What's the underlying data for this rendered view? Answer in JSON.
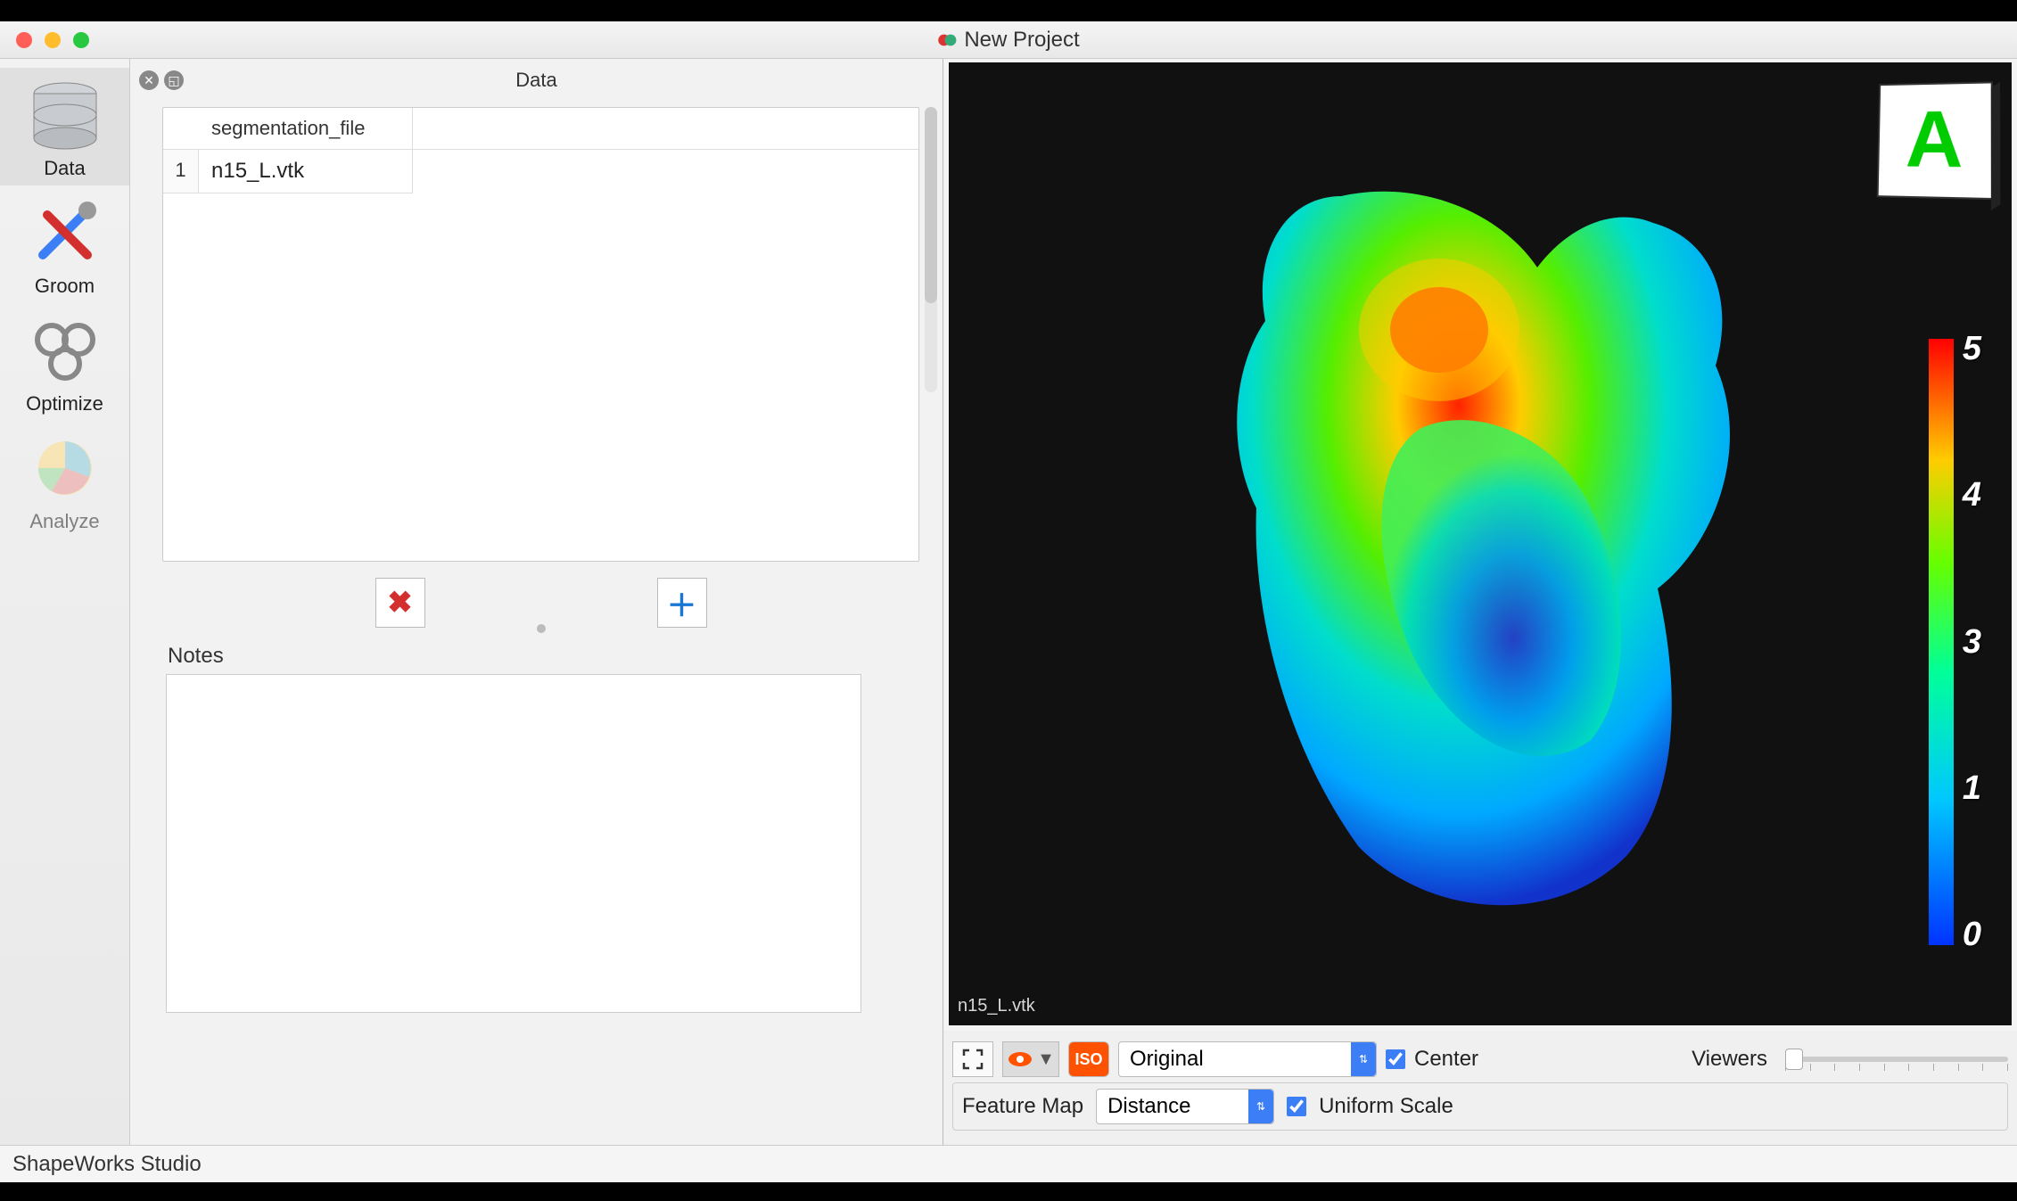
{
  "window": {
    "title": "New Project"
  },
  "sidebar": {
    "items": [
      {
        "label": "Data"
      },
      {
        "label": "Groom"
      },
      {
        "label": "Optimize"
      },
      {
        "label": "Analyze"
      }
    ]
  },
  "data_panel": {
    "title": "Data",
    "table": {
      "header": "segmentation_file",
      "rows": [
        {
          "index": "1",
          "value": "n15_L.vtk"
        }
      ]
    },
    "notes_label": "Notes",
    "notes_value": ""
  },
  "viewer": {
    "render_label": "n15_L.vtk",
    "orientation_letter": "A",
    "colorbar_ticks": [
      "5",
      "4",
      "3",
      "1",
      "0"
    ]
  },
  "controls": {
    "dropdown1": "Original",
    "center_label": "Center",
    "center_checked": true,
    "viewers_label": "Viewers",
    "iso_label": "ISO",
    "feature_map_label": "Feature Map",
    "feature_map_value": "Distance",
    "uniform_label": "Uniform Scale",
    "uniform_checked": true
  },
  "statusbar": {
    "text": "ShapeWorks Studio"
  }
}
